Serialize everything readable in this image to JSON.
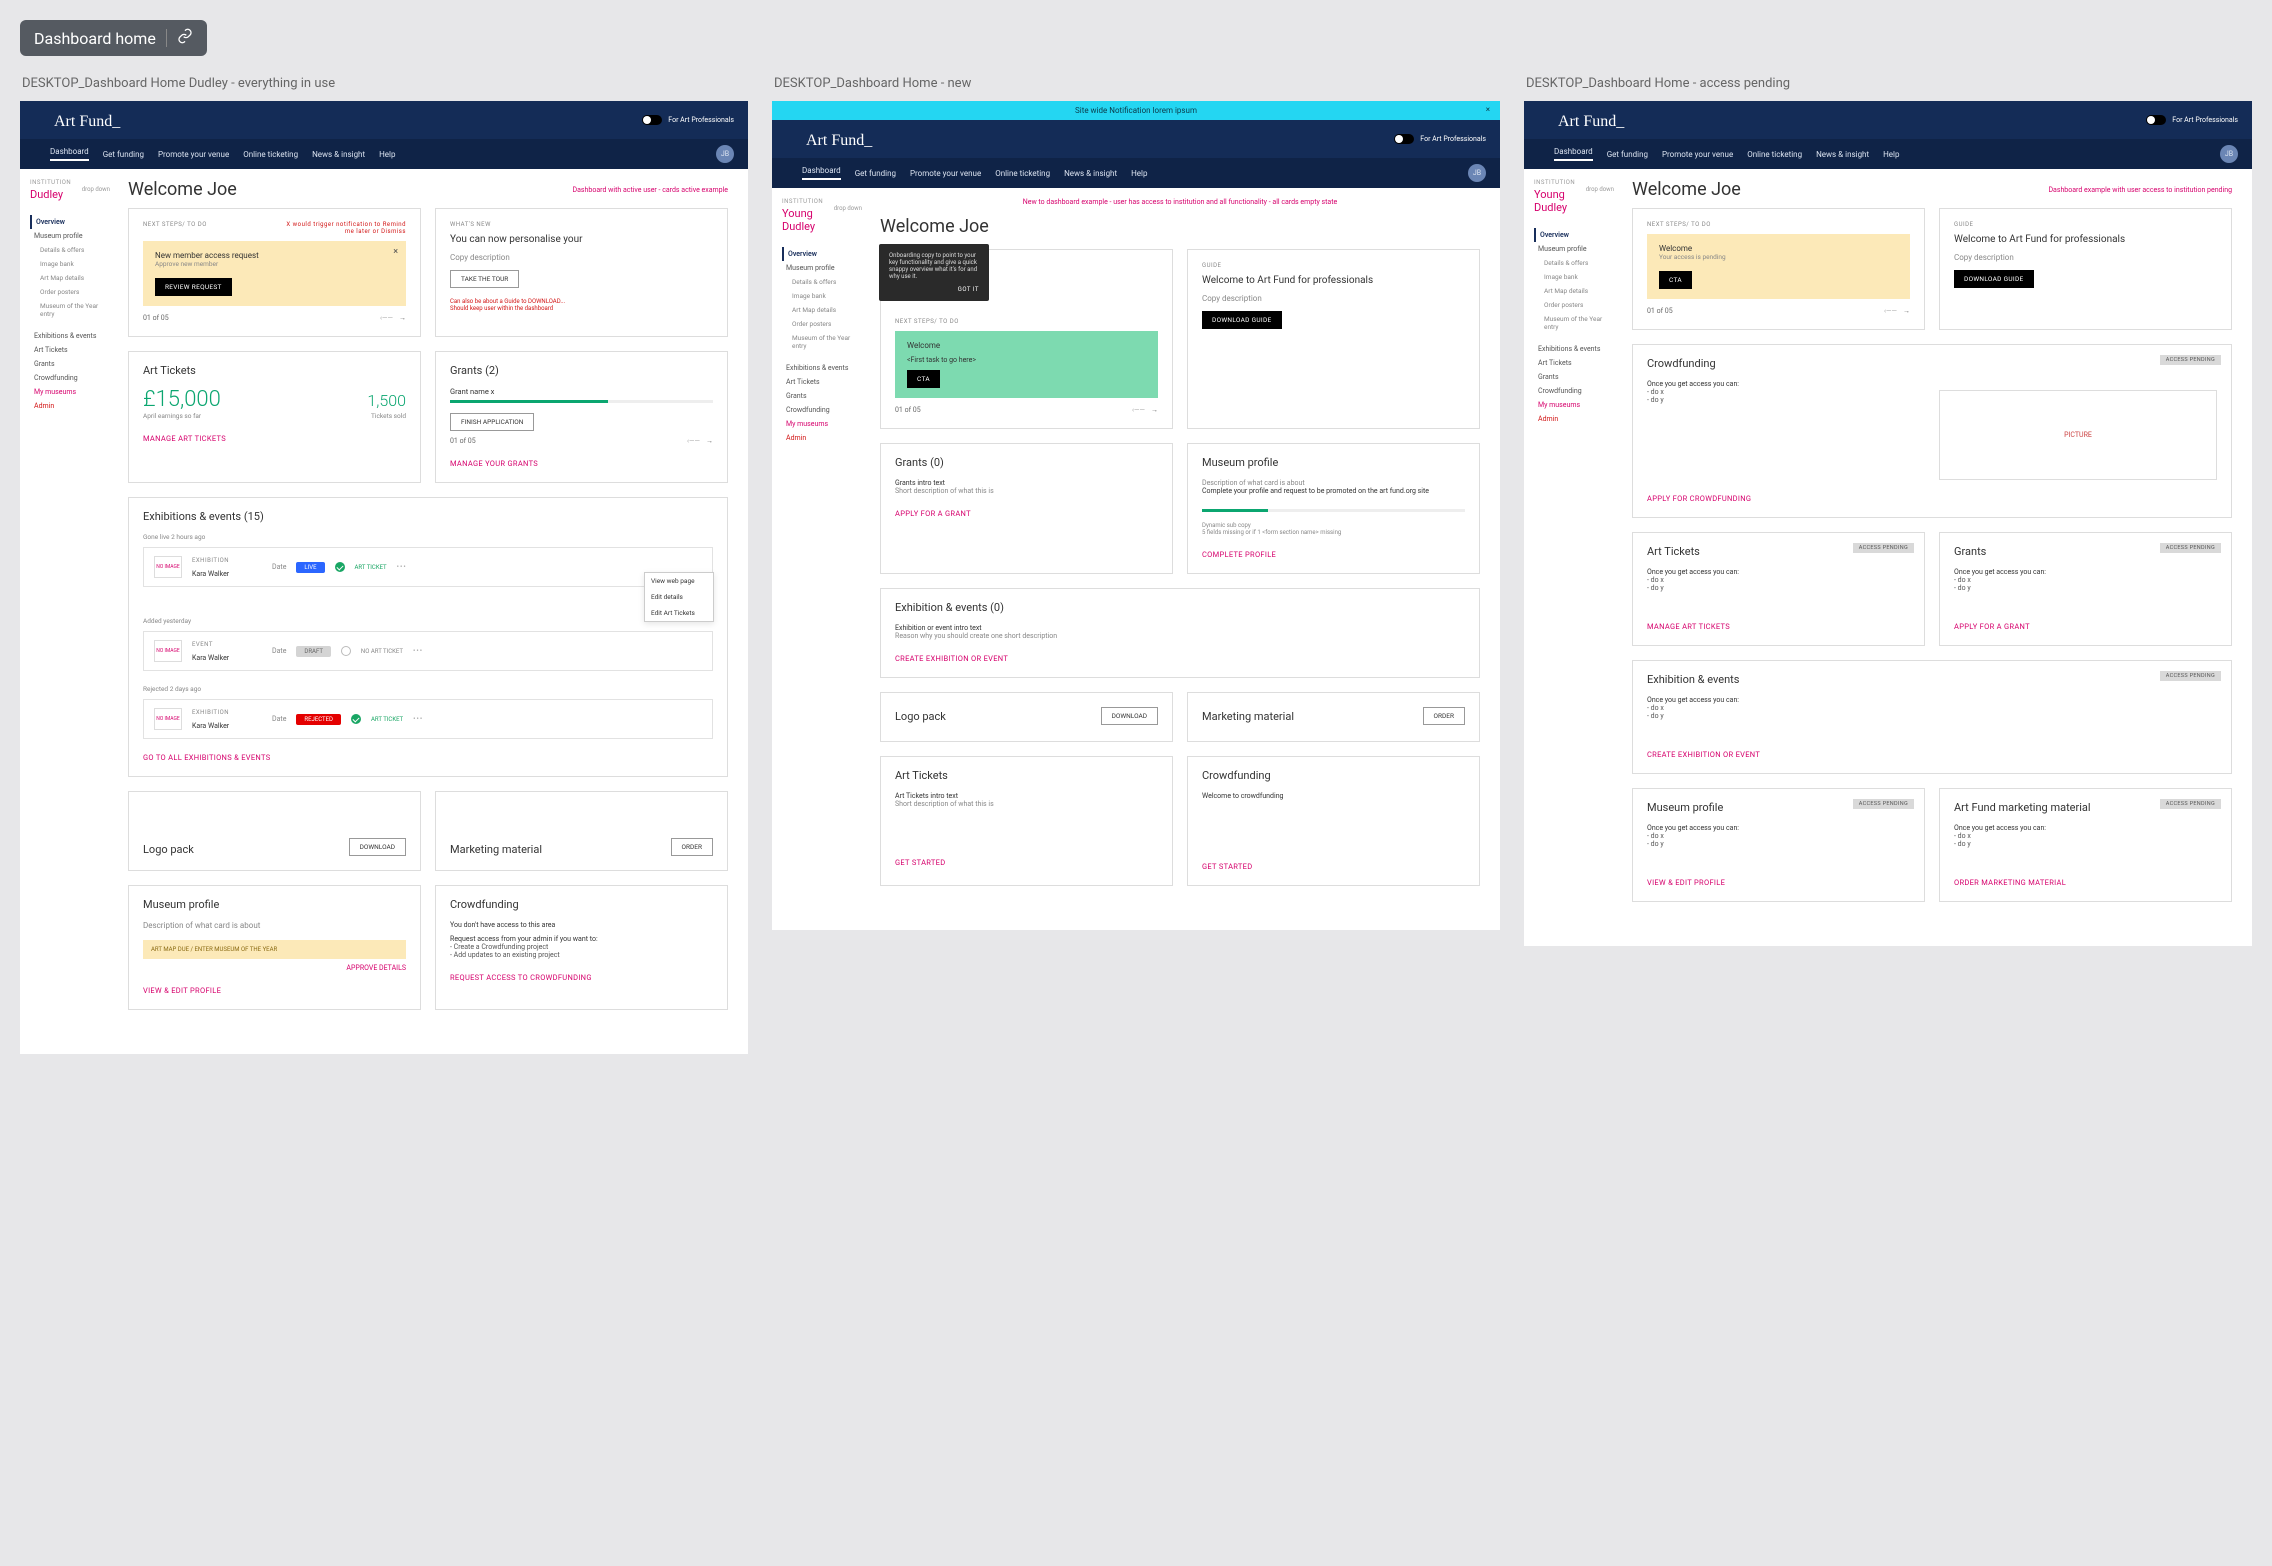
{
  "page_tag": "Dashboard home",
  "boards": {
    "a": {
      "title": "DESKTOP_Dashboard Home Dudley - everything in use"
    },
    "b": {
      "title": "DESKTOP_Dashboard Home - new"
    },
    "c": {
      "title": "DESKTOP_Dashboard Home - access pending"
    }
  },
  "brand": "Art Fund_",
  "top_right": "For Art Professionals",
  "nav": [
    "Dashboard",
    "Get funding",
    "Promote your venue",
    "Online ticketing",
    "News & insight",
    "Help"
  ],
  "avatar": "JB",
  "sidebar": {
    "inst_label": "INSTITUTION",
    "drop": "drop down",
    "dudley": "Dudley",
    "young": "Young Dudley",
    "overview": "Overview",
    "profile": "Museum profile",
    "sub": [
      "Details & offers",
      "Image bank",
      "Art Map details",
      "Order posters",
      "Museum of the Year entry"
    ],
    "exh": "Exhibitions & events",
    "tickets": "Art Tickets",
    "grants": "Grants",
    "crowd": "Crowdfunding",
    "my": "My museums",
    "admin": "Admin"
  },
  "welcome": "Welcome Joe",
  "notes": {
    "a": "Dashboard with active user - cards active example",
    "b": "New to dashboard example - user has access to institution and all functionality - all cards empty state",
    "c": "Dashboard example with user access to institution pending"
  },
  "next_steps": {
    "label": "NEXT STEPS/ TO DO",
    "trigger": "X would trigger notification to Remind me later or Dismiss",
    "a_title": "New member access request",
    "a_sub": "Approve new member",
    "a_btn": "REVIEW REQUEST",
    "b_welcome": "Welcome",
    "b_task": "<First task to go here>",
    "b_cta": "CTA",
    "c_welcome": "Welcome",
    "c_sub": "Your access is pending",
    "c_cta": "CTA",
    "pager": "01 of 05"
  },
  "whats_new": {
    "label": "WHAT'S NEW",
    "title": "You can now personalise your",
    "copy": "Copy description",
    "btn": "TAKE THE TOUR",
    "foot1": "Can also be about a Guide to DOWNLOAD...",
    "foot2": "Should keep user within the dashboard"
  },
  "guide": {
    "label": "GUIDE",
    "title": "Welcome to Art Fund for professionals",
    "copy": "Copy description",
    "btn": "DOWNLOAD GUIDE"
  },
  "tooltip": {
    "body": "Onboarding copy to point to your key functionality and give a quick snappy overview what it's for and why use it.",
    "got": "GOT IT"
  },
  "art_tickets": {
    "title": "Art Tickets",
    "amount": "£15,000",
    "sold": "1,500",
    "cap1": "April earnings so far",
    "cap2": "Tickets sold",
    "link": "MANAGE ART TICKETS"
  },
  "grants_card": {
    "title": "Grants (2)",
    "name": "Grant name x",
    "btn": "FINISH APPLICATION",
    "pager": "01 of 05",
    "link": "MANAGE YOUR GRANTS"
  },
  "exh": {
    "title": "Exhibitions & events (15)",
    "g1": "Gone live 2 hours ago",
    "g2": "Added yesterday",
    "g3": "Rejected 2 days ago",
    "type_exh": "EXHIBITION",
    "type_evt": "EVENT",
    "name": "Kara Walker",
    "date": "Date",
    "live": "LIVE",
    "draft": "DRAFT",
    "rej": "REJECTED",
    "ticket": "ART TICKET",
    "no_ticket": "NO ART TICKET",
    "no_image": "NO IMAGE",
    "menu": [
      "View web page",
      "Edit details",
      "Edit Art Tickets"
    ],
    "link": "GO TO ALL EXHIBITIONS & EVENTS"
  },
  "logo": {
    "title": "Logo pack",
    "btn": "DOWNLOAD"
  },
  "marketing": {
    "title": "Marketing material",
    "btn": "ORDER"
  },
  "museum": {
    "title": "Museum profile",
    "desc": "Description of what card is about",
    "bar": "ART MAP DUE / ENTER MUSEUM OF THE YEAR",
    "approve": "APPROVE DETAILS",
    "link": "VIEW & EDIT PROFILE"
  },
  "crowd": {
    "title": "Crowdfunding",
    "no_access": "You don't have access to this area",
    "req": "Request access from your admin if you want to:",
    "li1": "Create a Crowdfunding project",
    "li2": "Add updates to an existing project",
    "link": "REQUEST ACCESS TO CROWDFUNDING"
  },
  "b": {
    "notif": "Site wide Notification lorem ipsum",
    "grants_title": "Grants (0)",
    "grants_intro": "Grants intro text",
    "grants_desc": "Short description of what this is",
    "grants_link": "APPLY FOR A GRANT",
    "mprofile_title": "Museum profile",
    "mprofile_desc": "Description of what card is about",
    "mprofile_sub": "Complete your profile and request to be promoted on the art fund.org site",
    "mprofile_dyn": "Dynamic sub copy",
    "mprofile_fields": "5 fields missing or if 1 <form section name> missing",
    "mprofile_link": "COMPLETE PROFILE",
    "exh_title": "Exhibition & events (0)",
    "exh_intro": "Exhibition or event intro text",
    "exh_desc": "Reason why you should create one short description",
    "exh_link": "CREATE EXHIBITION OR EVENT",
    "tickets_title": "Art Tickets",
    "tickets_intro": "Art Tickets intro text",
    "tickets_desc": "Short description of what this is",
    "tickets_link": "GET STARTED",
    "crowd_title": "Crowdfunding",
    "crowd_intro": "Welcome to crowdfunding",
    "crowd_link": "GET STARTED"
  },
  "c": {
    "pending": "ACCESS PENDING",
    "once": "Once you get access you can:",
    "x": "do x",
    "y": "do y",
    "crowd_link": "APPLY FOR CROWDFUNDING",
    "tickets_link": "MANAGE ART TICKETS",
    "grants_link": "APPLY FOR A GRANT",
    "exh_title": "Exhibition & events",
    "exh_link": "CREATE EXHIBITION OR EVENT",
    "mprofile_link": "VIEW & EDIT PROFILE",
    "mkt_title": "Art Fund marketing material",
    "mkt_link": "ORDER MARKETING MATERIAL",
    "picture": "PICTURE"
  }
}
